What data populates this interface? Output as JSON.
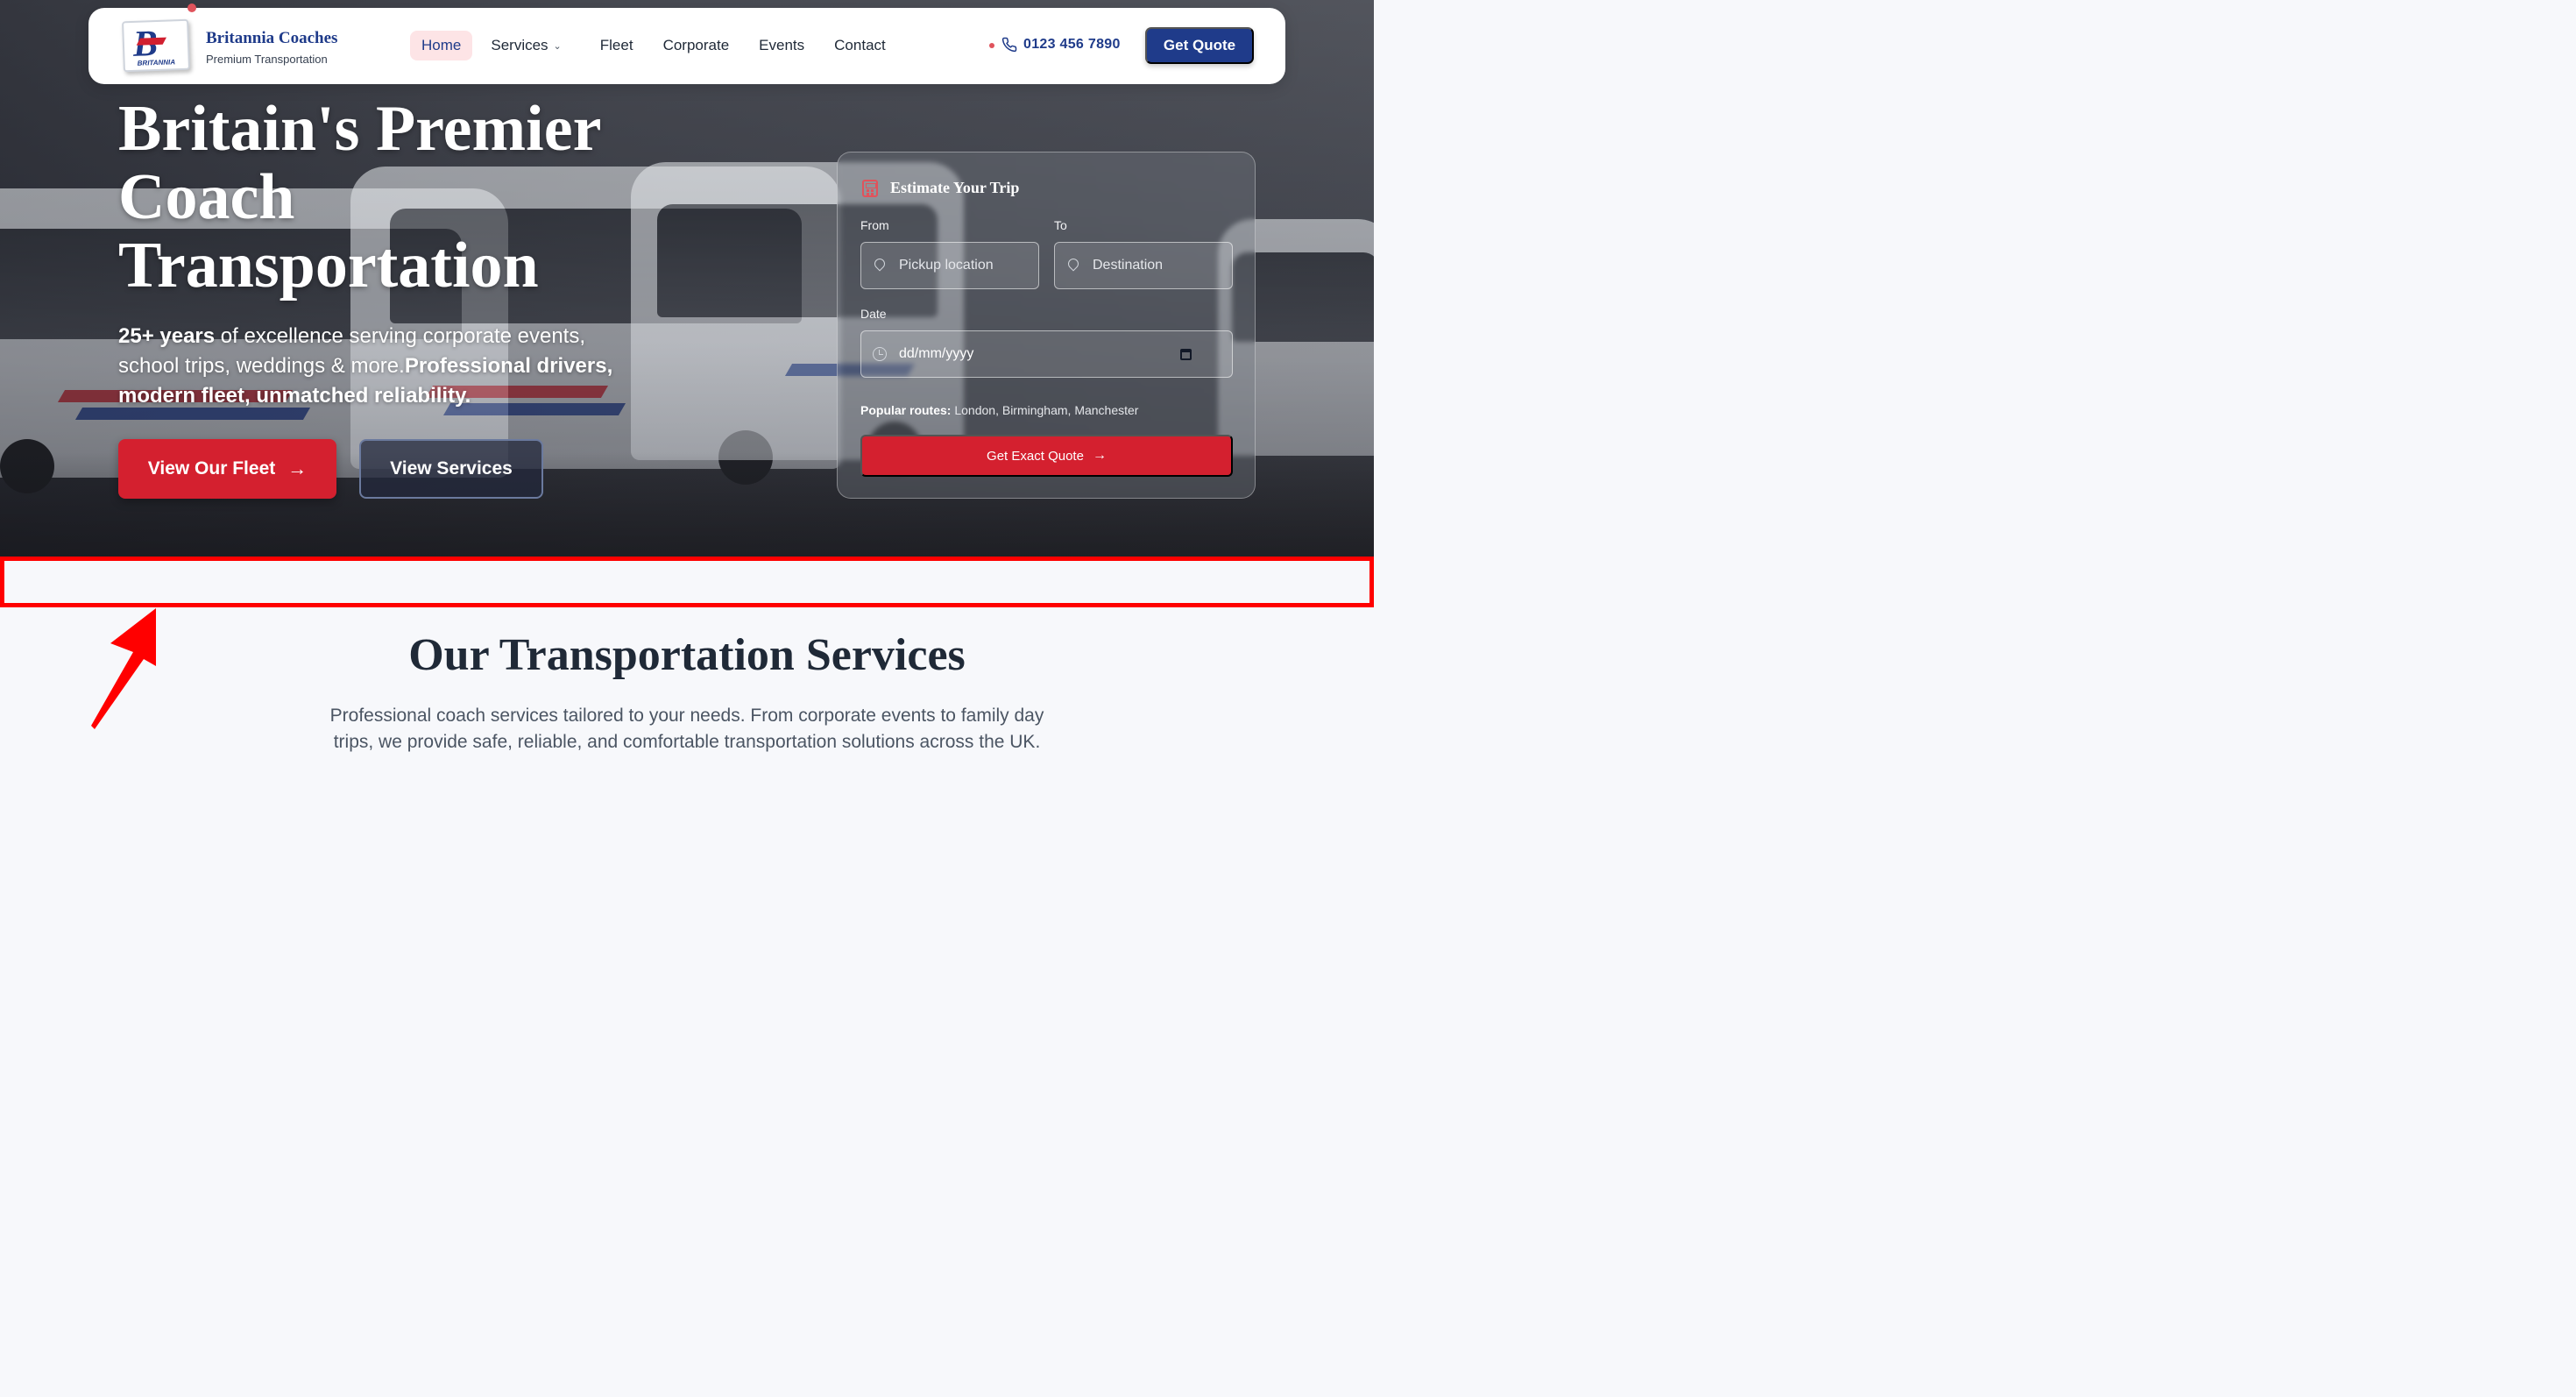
{
  "nav": {
    "brand_name": "Britannia Coaches",
    "brand_tagline": "Premium Transportation",
    "logo_text": "BRITANNIA",
    "links": [
      {
        "label": "Home",
        "active": true
      },
      {
        "label": "Services",
        "has_dropdown": true
      },
      {
        "label": "Fleet"
      },
      {
        "label": "Corporate"
      },
      {
        "label": "Events"
      },
      {
        "label": "Contact"
      }
    ],
    "phone": "0123 456 7890",
    "cta_label": "Get Quote"
  },
  "hero": {
    "title": "Britain's Premier Coach Transportation",
    "subtitle_bold_1": "25+ years",
    "subtitle_text_1": " of excellence serving corporate events, school trips, weddings & more.",
    "subtitle_bold_2": "Professional drivers, modern fleet, unmatched reliability.",
    "primary_button": "View Our Fleet",
    "secondary_button": "View Services"
  },
  "estimate": {
    "title": "Estimate Your Trip",
    "from_label": "From",
    "from_placeholder": "Pickup location",
    "to_label": "To",
    "to_placeholder": "Destination",
    "date_label": "Date",
    "date_placeholder": "dd/mm/yyyy",
    "routes_label": "Popular routes:",
    "routes_value": " London, Birmingham, Manchester",
    "button": "Get Exact Quote"
  },
  "services": {
    "title": "Our Transportation Services",
    "description": "Professional coach services tailored to your needs. From corporate events to family day trips, we provide safe, reliable, and comfortable transportation solutions across the UK."
  },
  "colors": {
    "brand_blue": "#1f3b8a",
    "brand_red": "#d4202f",
    "highlight": "#ff0000"
  },
  "icons": [
    "phone-icon",
    "chevron-down-icon",
    "arrow-right-icon",
    "calculator-icon",
    "map-pin-icon",
    "clock-icon",
    "calendar-icon"
  ]
}
